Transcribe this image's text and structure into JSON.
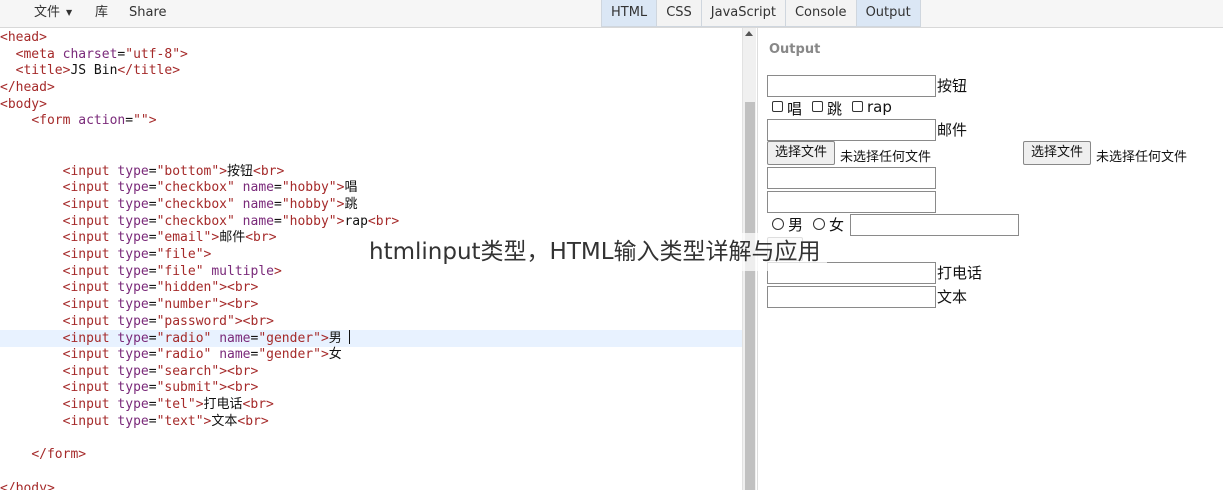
{
  "menu": {
    "file_label": "文件",
    "library_label": "库",
    "share_label": "Share"
  },
  "tabs": [
    {
      "label": "HTML",
      "active": true
    },
    {
      "label": "CSS",
      "active": false
    },
    {
      "label": "JavaScript",
      "active": false
    },
    {
      "label": "Console",
      "active": false
    },
    {
      "label": "Output",
      "active": true
    }
  ],
  "editor": {
    "current_line": 19,
    "lines": [
      "<head>",
      "  <meta charset=\"utf-8\">",
      "  <title>JS Bin</title>",
      "</head>",
      "<body>",
      "    <form action=\"\">",
      "",
      "",
      "        <input type=\"bottom\">按钮<br>",
      "        <input type=\"checkbox\" name=\"hobby\">唱",
      "        <input type=\"checkbox\" name=\"hobby\">跳",
      "        <input type=\"checkbox\" name=\"hobby\">rap<br>",
      "        <input type=\"email\">邮件<br>",
      "        <input type=\"file\">",
      "        <input type=\"file\" multiple>",
      "        <input type=\"hidden\"><br>",
      "        <input type=\"number\"><br>",
      "        <input type=\"password\"><br>",
      "        <input type=\"radio\" name=\"gender\">男",
      "        <input type=\"radio\" name=\"gender\">女",
      "        <input type=\"search\"><br>",
      "        <input type=\"submit\"><br>",
      "        <input type=\"tel\">打电话<br>",
      "        <input type=\"text\">文本<br>",
      "",
      "    </form>",
      "",
      "</body>"
    ]
  },
  "output": {
    "title": "Output",
    "button_text_label": "按钮",
    "check_sing": "唱",
    "check_jump": "跳",
    "check_rap": "rap",
    "email_label": "邮件",
    "file_button_label": "选择文件",
    "file_none_label": "未选择任何文件",
    "radio_male": "男",
    "radio_female": "女",
    "tel_label": "打电话",
    "text_label": "文本"
  },
  "caption": "htmlinput类型，HTML输入类型详解与应用"
}
